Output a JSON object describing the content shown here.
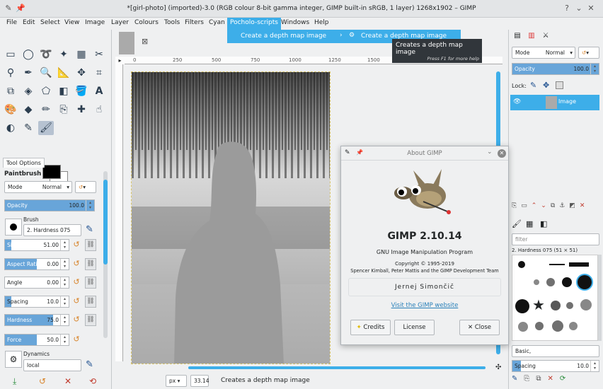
{
  "window": {
    "title": "*[girl-photo] (imported)-3.0 (RGB colour 8-bit gamma integer, GIMP built-in sRGB, 1 layer) 1268x1902 – GIMP"
  },
  "menu": [
    "File",
    "Edit",
    "Select",
    "View",
    "Image",
    "Layer",
    "Colours",
    "Tools",
    "Filters",
    "Cyan",
    "Pocholo-scripts",
    "Windows",
    "Help"
  ],
  "submenu": {
    "item": "Create a depth map image",
    "subitem": "Create a depth map image"
  },
  "tooltip": {
    "text": "Creates a depth map image",
    "hint": "Press F1 for more help"
  },
  "tool_options": {
    "tab": "Tool Options",
    "tool": "Paintbrush",
    "mode_label": "Mode",
    "mode_value": "Normal",
    "opacity": {
      "label": "Opacity",
      "value": "100.0",
      "fraction": 1.0
    },
    "brush_label": "Brush",
    "brush_value": "2. Hardness 075",
    "size": {
      "label": "Size",
      "value": "51.00",
      "fraction": 0.1
    },
    "aspect": {
      "label": "Aspect Ratio",
      "value": "0.00",
      "fraction": 0.5
    },
    "angle": {
      "label": "Angle",
      "value": "0.00",
      "fraction": 0.0
    },
    "spacing": {
      "label": "Spacing",
      "value": "10.0",
      "fraction": 0.1
    },
    "hardness": {
      "label": "Hardness",
      "value": "75.0",
      "fraction": 0.75
    },
    "force": {
      "label": "Force",
      "value": "50.0",
      "fraction": 0.5
    },
    "dynamics_label": "Dynamics",
    "dynamics_value": "local"
  },
  "ruler": {
    "ticks": [
      "0",
      "250",
      "500",
      "750",
      "1000",
      "1250",
      "1500",
      "1750",
      "2000"
    ]
  },
  "status": {
    "unit": "px",
    "zoom": "33.14",
    "message": "Creates a depth map image"
  },
  "about": {
    "title": "About GIMP",
    "name": "GIMP 2.10.14",
    "subtitle": "GNU Image Manipulation Program",
    "copyright": "Copyright © 1995-2019",
    "authors": "Spencer Kimball, Peter Mattis and the GIMP Development Team",
    "contributor": "Jernej Simončič",
    "link": "Visit the GIMP website",
    "btn_credits": "Credits",
    "btn_license": "License",
    "btn_close": "Close"
  },
  "layers": {
    "mode_label": "Mode",
    "mode_value": "Normal",
    "opacity": {
      "label": "Opacity",
      "value": "100.0",
      "fraction": 1.0
    },
    "lock_label": "Lock:",
    "layer_name": "Image"
  },
  "brushes": {
    "filter_placeholder": "filter",
    "current": "2. Hardness 075 (51 × 51)",
    "preset": "Basic,",
    "spacing": {
      "label": "Spacing",
      "value": "10.0",
      "fraction": 0.1
    }
  }
}
